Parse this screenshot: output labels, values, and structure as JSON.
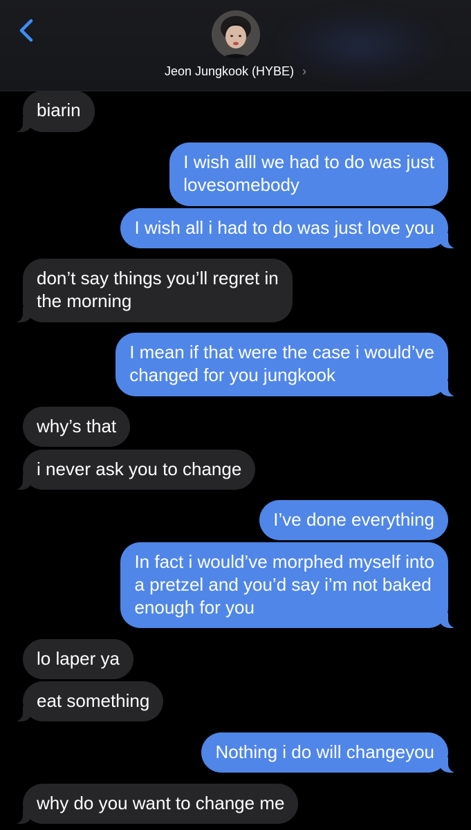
{
  "header": {
    "contact_name": "Jeon Jungkook (HYBE)",
    "chevron": "›",
    "back_icon": "chevron-left-icon",
    "accent_color": "#3d8ef7"
  },
  "messages": [
    {
      "sender": "them",
      "text": "biarin"
    },
    {
      "sender": "me",
      "lines": [
        "I wish alll we had to do was just",
        "lovesomebody"
      ]
    },
    {
      "sender": "me",
      "text": "I wish all i had to do was just love you"
    },
    {
      "sender": "them",
      "lines": [
        "don’t say things you’ll regret in",
        "the morning"
      ]
    },
    {
      "sender": "me",
      "lines": [
        "I mean if that were the case i would’ve",
        "changed for you jungkook"
      ]
    },
    {
      "sender": "them",
      "text": "why’s that"
    },
    {
      "sender": "them",
      "text": "i never ask you to change"
    },
    {
      "sender": "me",
      "text": "I’ve done everything"
    },
    {
      "sender": "me",
      "lines": [
        "In fact i would’ve morphed myself into",
        "a pretzel and you’d say i’m not baked",
        "enough for you"
      ]
    },
    {
      "sender": "them",
      "text": "lo laper ya"
    },
    {
      "sender": "them",
      "text": "eat something"
    },
    {
      "sender": "me",
      "text": "Nothing i do will changeyou"
    },
    {
      "sender": "them",
      "text": "why do you want to change me"
    }
  ],
  "colors": {
    "incoming_bubble": "#262629",
    "outgoing_bubble": "#4f86e8",
    "background": "#000000"
  }
}
